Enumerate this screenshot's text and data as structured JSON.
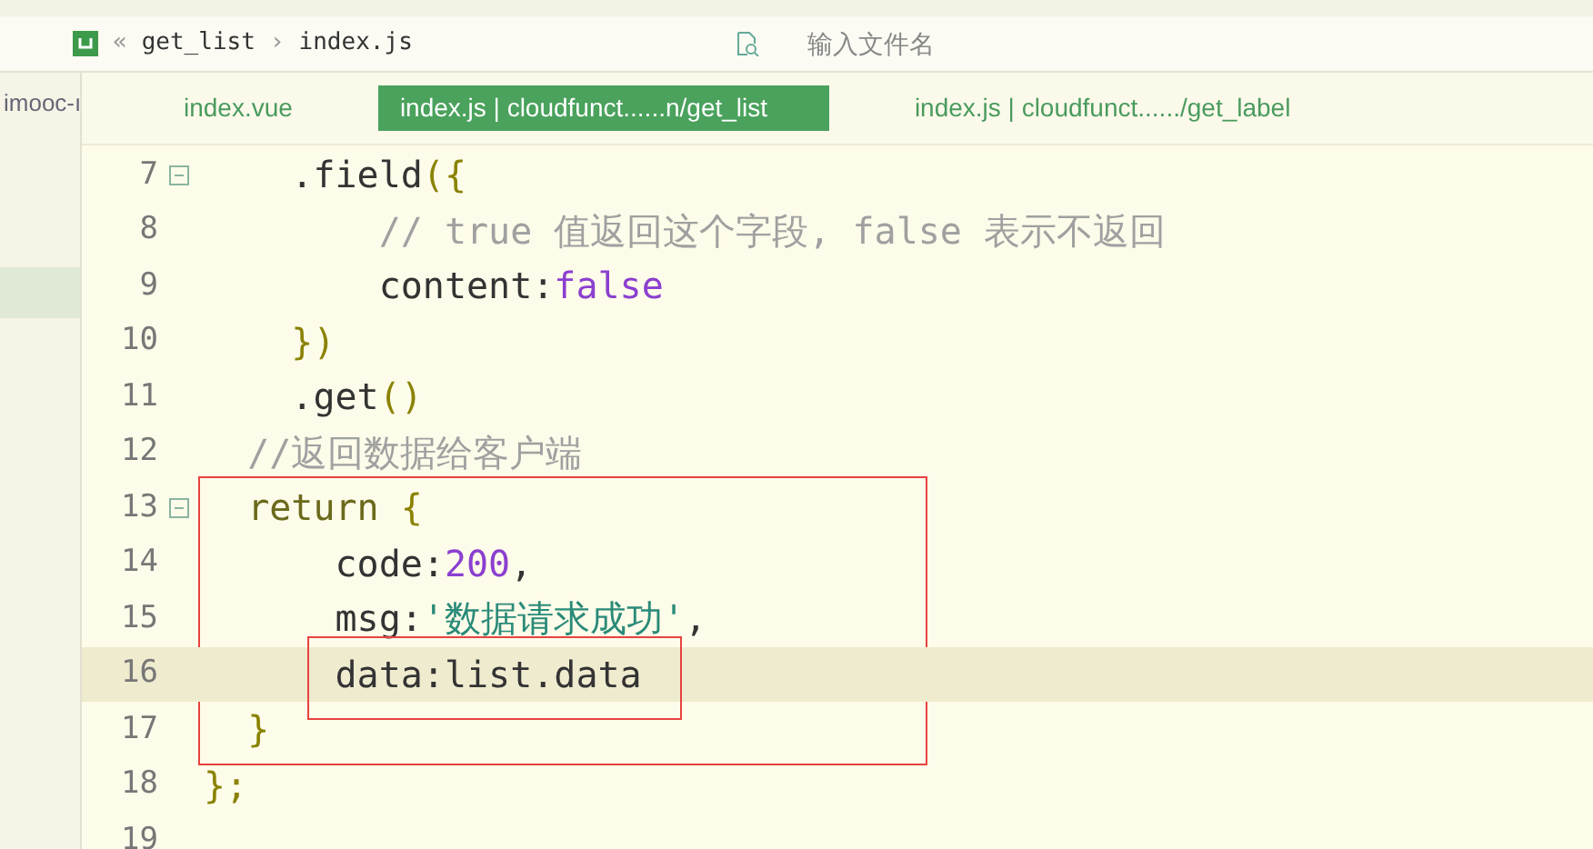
{
  "breadcrumb": {
    "items": [
      {
        "text": "«",
        "kind": "sep"
      },
      {
        "text": "get_list",
        "kind": "crumb"
      },
      {
        "text": "›",
        "kind": "sep"
      },
      {
        "text": "index.js",
        "kind": "crumb"
      }
    ]
  },
  "file_search": {
    "placeholder": "输入文件名"
  },
  "sidebar": {
    "items": [
      {
        "label": "imooc-ı",
        "selected": false
      },
      {
        "selected": true
      }
    ]
  },
  "tabs": [
    {
      "label": "index.vue",
      "selected": false
    },
    {
      "label": "index.js | cloudfunct......n/get_list",
      "selected": true
    },
    {
      "label": "index.js | cloudfunct....../get_label",
      "selected": false
    }
  ],
  "editor": {
    "blocks": [
      {
        "framed": false,
        "lines": [
          {
            "number": "7",
            "fold": true,
            "current": false,
            "boxed": false,
            "tokens": [
              {
                "text": "    .field",
                "kind": "plain"
              },
              {
                "text": "({",
                "kind": "punct"
              }
            ]
          },
          {
            "number": "8",
            "fold": false,
            "current": false,
            "boxed": false,
            "tokens": [
              {
                "text": "        // true 值返回这个字段, false 表示不返回",
                "kind": "comment"
              }
            ]
          },
          {
            "number": "9",
            "fold": false,
            "current": false,
            "boxed": false,
            "tokens": [
              {
                "text": "        content:",
                "kind": "plain"
              },
              {
                "text": "false",
                "kind": "literal"
              }
            ]
          },
          {
            "number": "10",
            "fold": false,
            "current": false,
            "boxed": false,
            "tokens": [
              {
                "text": "    })",
                "kind": "punct"
              }
            ]
          },
          {
            "number": "11",
            "fold": false,
            "current": false,
            "boxed": false,
            "tokens": [
              {
                "text": "    .get",
                "kind": "plain"
              },
              {
                "text": "()",
                "kind": "punct"
              }
            ]
          },
          {
            "number": "12",
            "fold": false,
            "current": false,
            "boxed": false,
            "tokens": [
              {
                "text": "  //返回数据给客户端",
                "kind": "comment"
              }
            ]
          }
        ]
      },
      {
        "framed": true,
        "lines": [
          {
            "number": "13",
            "fold": true,
            "current": false,
            "boxed": false,
            "tokens": [
              {
                "text": "  return",
                "kind": "keyword"
              },
              {
                "text": " {",
                "kind": "punct"
              }
            ]
          },
          {
            "number": "14",
            "fold": false,
            "current": false,
            "boxed": false,
            "tokens": [
              {
                "text": "      code:",
                "kind": "plain"
              },
              {
                "text": "200",
                "kind": "literal"
              },
              {
                "text": ",",
                "kind": "plain"
              }
            ]
          },
          {
            "number": "15",
            "fold": false,
            "current": false,
            "boxed": false,
            "tokens": [
              {
                "text": "      msg:",
                "kind": "plain"
              },
              {
                "text": "'数据请求成功'",
                "kind": "string"
              },
              {
                "text": ",",
                "kind": "plain"
              }
            ]
          },
          {
            "number": "16",
            "fold": false,
            "current": true,
            "boxed": true,
            "tokens": [
              {
                "text": "      data:list.data",
                "kind": "plain"
              }
            ]
          },
          {
            "number": "17",
            "fold": false,
            "current": false,
            "boxed": false,
            "tokens": [
              {
                "text": "  }",
                "kind": "punct"
              }
            ]
          }
        ]
      },
      {
        "framed": false,
        "lines": [
          {
            "number": "18",
            "fold": false,
            "current": false,
            "boxed": false,
            "tokens": [
              {
                "text": "};",
                "kind": "punct"
              }
            ]
          },
          {
            "number": "19",
            "fold": false,
            "current": false,
            "boxed": false
          }
        ]
      }
    ]
  }
}
